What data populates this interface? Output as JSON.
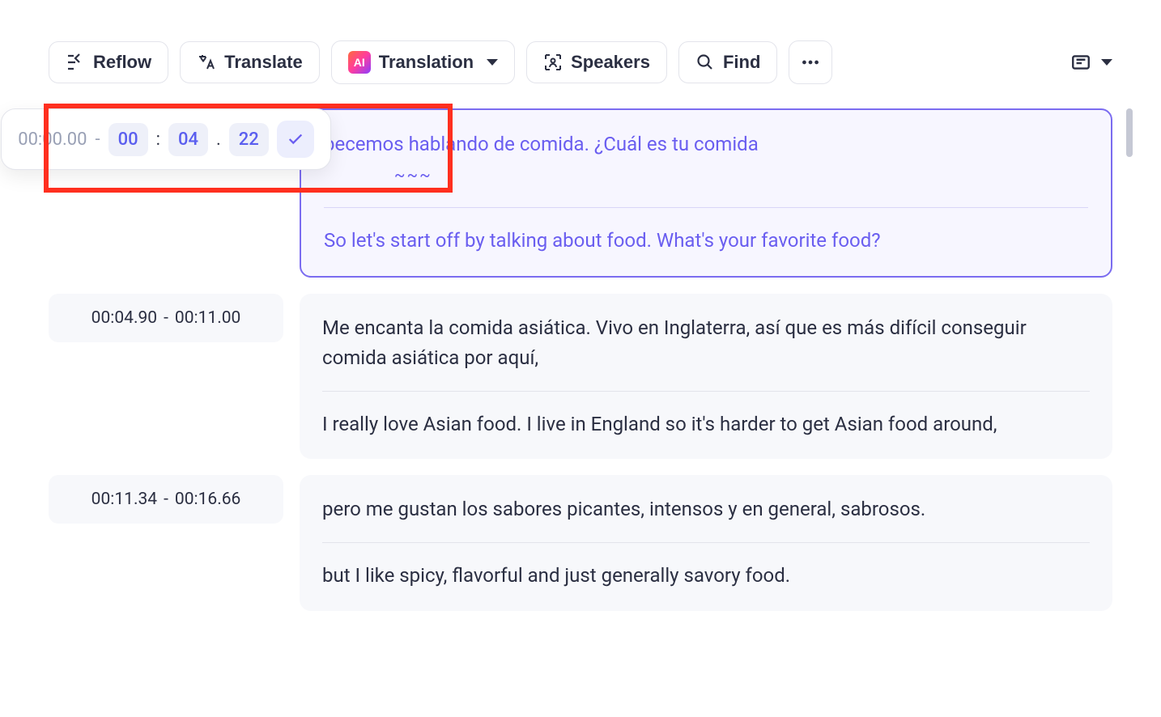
{
  "toolbar": {
    "reflow": "Reflow",
    "translate": "Translate",
    "translation": "Translation",
    "speakers": "Speakers",
    "find": "Find"
  },
  "timestamp_editor": {
    "start": "00:00.00",
    "end_mm": "00",
    "end_ss": "04",
    "end_cs": "22"
  },
  "segments": [
    {
      "active": true,
      "start": "00:00.00",
      "end": "00:04.22",
      "original": "pecemos hablando de comida. ¿Cuál es tu comida",
      "original_suffix": "~~~",
      "translation": "So let's start off by talking about food. What's your favorite food?"
    },
    {
      "active": false,
      "start": "00:04.90",
      "end": "00:11.00",
      "original": "Me encanta la comida asiática. Vivo en Inglaterra, así que es más difícil conseguir comida asiática por aquí,",
      "translation": "I really love Asian food. I live in England so it's harder to get Asian food around,"
    },
    {
      "active": false,
      "start": "00:11.34",
      "end": "00:16.66",
      "original": "pero me gustan los sabores picantes, intensos y en general, sabrosos.",
      "translation": "but I like spicy, flavorful and just generally savory food."
    }
  ]
}
